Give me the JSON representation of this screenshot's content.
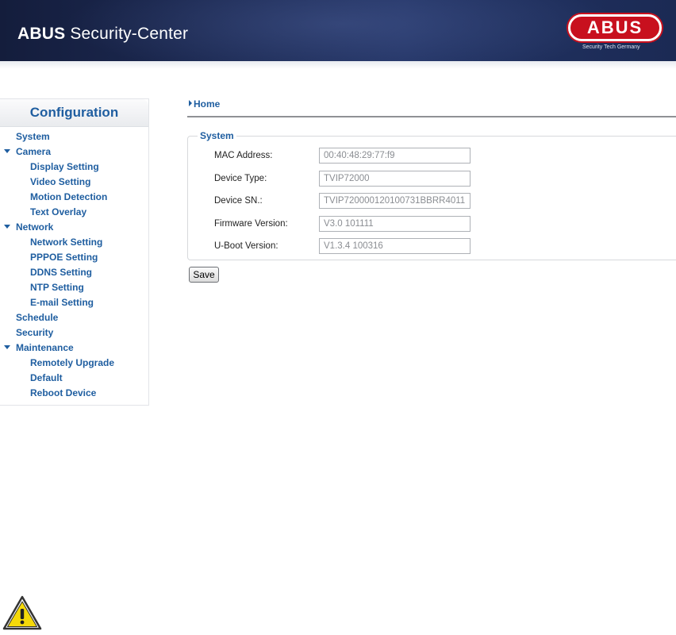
{
  "header": {
    "title_bold": "ABUS",
    "title_rest": " Security-Center",
    "logo_text": "ABUS",
    "tagline": "Security Tech Germany"
  },
  "sidebar": {
    "title": "Configuration",
    "items": [
      {
        "label": "System",
        "level": 1,
        "expanded": false
      },
      {
        "label": "Camera",
        "level": 1,
        "expanded": true
      },
      {
        "label": "Display Setting",
        "level": 2
      },
      {
        "label": "Video Setting",
        "level": 2
      },
      {
        "label": "Motion Detection",
        "level": 2
      },
      {
        "label": "Text Overlay",
        "level": 2
      },
      {
        "label": "Network",
        "level": 1,
        "expanded": true
      },
      {
        "label": "Network Setting",
        "level": 2
      },
      {
        "label": "PPPOE Setting",
        "level": 2
      },
      {
        "label": "DDNS Setting",
        "level": 2
      },
      {
        "label": "NTP Setting",
        "level": 2
      },
      {
        "label": "E-mail Setting",
        "level": 2
      },
      {
        "label": "Schedule",
        "level": 1,
        "expanded": false
      },
      {
        "label": "Security",
        "level": 1,
        "expanded": false
      },
      {
        "label": "Maintenance",
        "level": 1,
        "expanded": true
      },
      {
        "label": "Remotely Upgrade",
        "level": 2
      },
      {
        "label": "Default",
        "level": 2
      },
      {
        "label": "Reboot Device",
        "level": 2
      }
    ]
  },
  "main": {
    "breadcrumb": "Home",
    "section_title": "System",
    "fields": [
      {
        "label": "MAC Address:",
        "value": "00:40:48:29:77:f9"
      },
      {
        "label": "Device Type:",
        "value": "TVIP72000"
      },
      {
        "label": "Device SN.:",
        "value": "TVIP720000120100731BBRR4011"
      },
      {
        "label": "Firmware Version:",
        "value": "V3.0  101111"
      },
      {
        "label": "U-Boot Version:",
        "value": "V1.3.4  100316"
      }
    ],
    "save_label": "Save"
  },
  "icons": {
    "warning": "warning-icon"
  },
  "colors": {
    "header_bg": "#1d2b55",
    "accent_blue": "#1f5ea0",
    "logo_red": "#c8101e",
    "warning_yellow": "#f5d90a"
  }
}
